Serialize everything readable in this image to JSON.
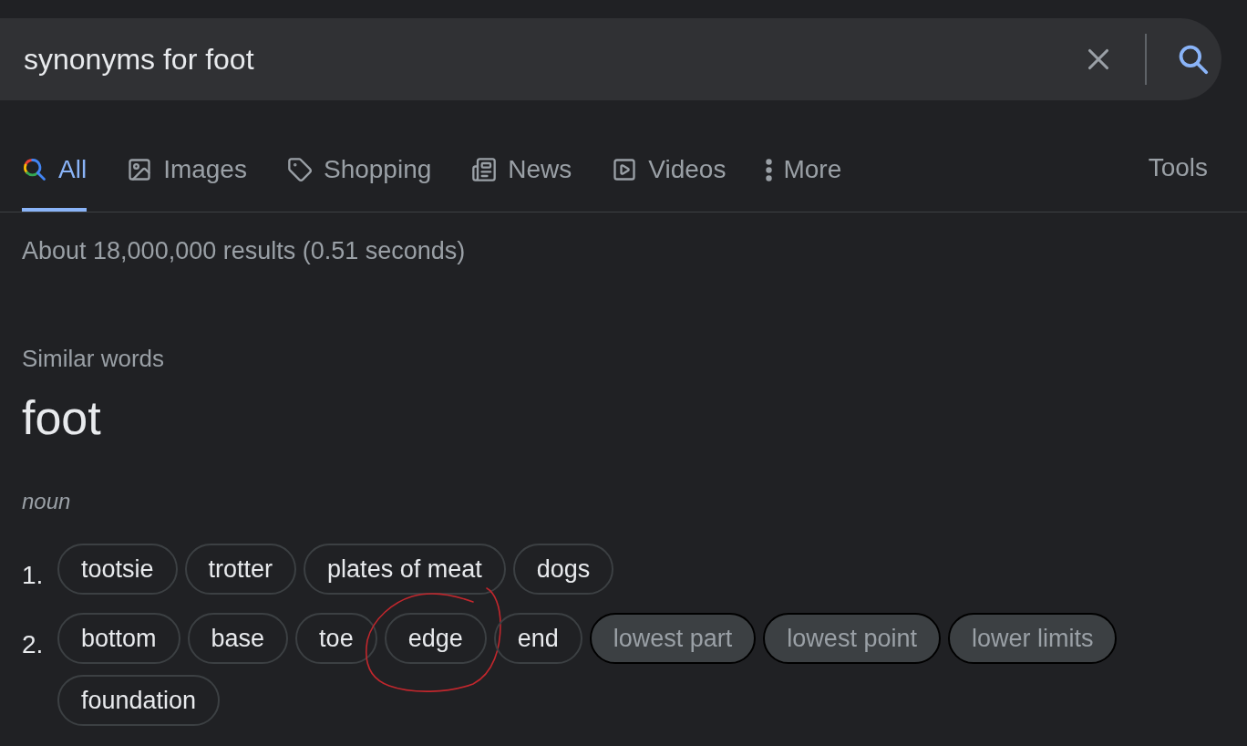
{
  "search": {
    "value": "synonyms for foot"
  },
  "tabs": [
    {
      "label": "All",
      "selected": true
    },
    {
      "label": "Images",
      "selected": false
    },
    {
      "label": "Shopping",
      "selected": false
    },
    {
      "label": "News",
      "selected": false
    },
    {
      "label": "Videos",
      "selected": false
    },
    {
      "label": "More",
      "selected": false
    }
  ],
  "tools": "Tools",
  "result_stats": "About 18,000,000 results (0.51 seconds)",
  "card": {
    "heading": "Similar words",
    "word": "foot",
    "part_of_speech": "noun",
    "senses": [
      {
        "number": "1.",
        "synonyms": [
          {
            "text": "tootsie",
            "kind": "outlined",
            "circled": false
          },
          {
            "text": "trotter",
            "kind": "outlined",
            "circled": false
          },
          {
            "text": "plates of meat",
            "kind": "outlined",
            "circled": false
          },
          {
            "text": "dogs",
            "kind": "outlined",
            "circled": false
          }
        ]
      },
      {
        "number": "2.",
        "synonyms": [
          {
            "text": "bottom",
            "kind": "outlined",
            "circled": false
          },
          {
            "text": "base",
            "kind": "outlined",
            "circled": false
          },
          {
            "text": "toe",
            "kind": "outlined",
            "circled": false
          },
          {
            "text": "edge",
            "kind": "outlined",
            "circled": true
          },
          {
            "text": "end",
            "kind": "outlined",
            "circled": false
          },
          {
            "text": "lowest part",
            "kind": "filled",
            "circled": false
          },
          {
            "text": "lowest point",
            "kind": "filled",
            "circled": false
          },
          {
            "text": "lower limits",
            "kind": "filled",
            "circled": false
          },
          {
            "text": "foundation",
            "kind": "outlined",
            "circled": false
          }
        ]
      }
    ]
  }
}
